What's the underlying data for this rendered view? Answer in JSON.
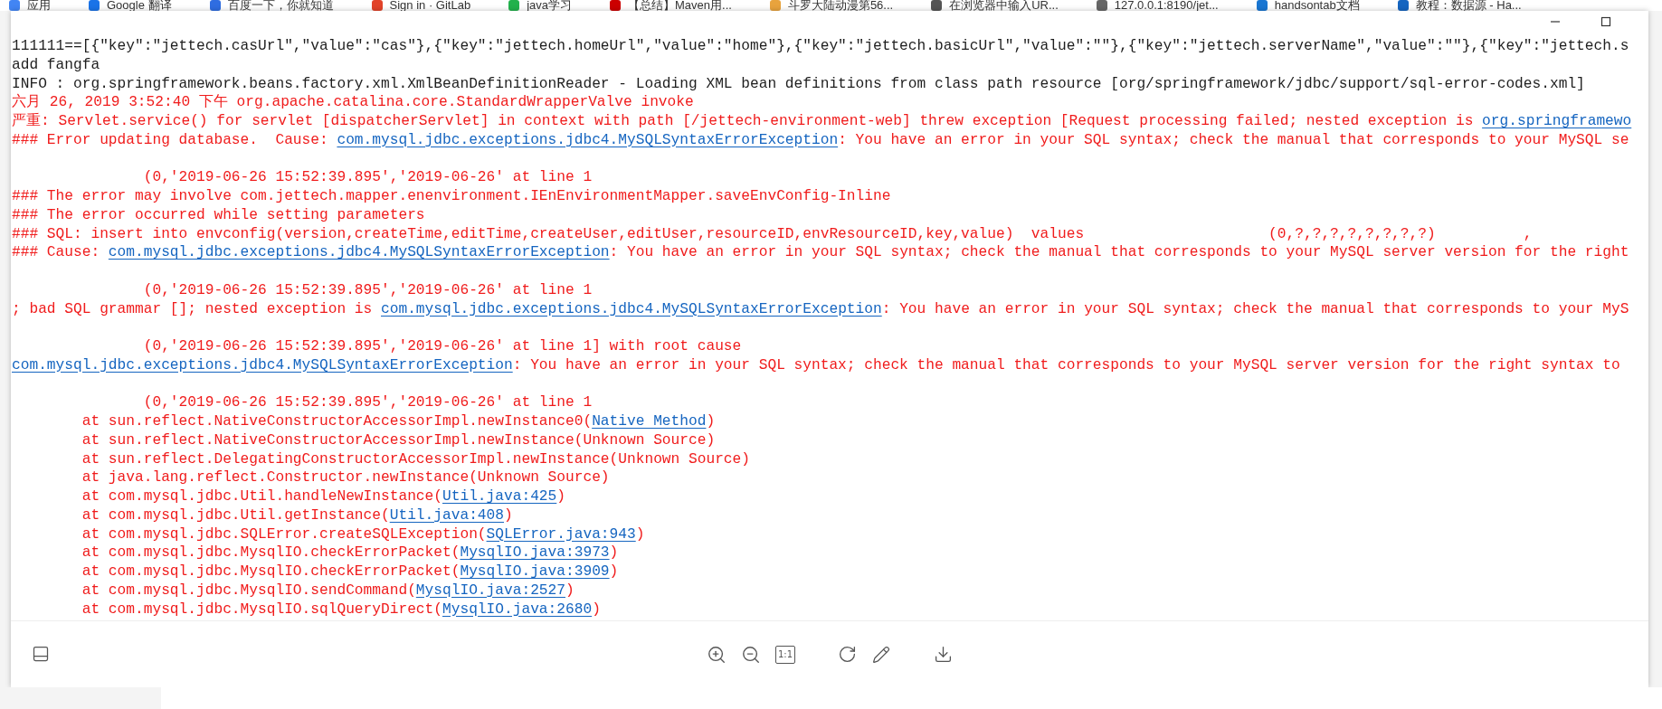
{
  "bookmarks": [
    {
      "label": "应用"
    },
    {
      "label": "Google 翻译"
    },
    {
      "label": "百度一下，你就知道"
    },
    {
      "label": "Sign in · GitLab"
    },
    {
      "label": "java学习"
    },
    {
      "label": "【总结】Maven用..."
    },
    {
      "label": "斗罗大陆动漫第56..."
    },
    {
      "label": "在浏览器中输入UR..."
    },
    {
      "label": "127.0.0.1:8190/jet..."
    },
    {
      "label": "handsontab文档"
    },
    {
      "label": "教程：数据源 - Ha..."
    }
  ],
  "log_lines": [
    {
      "kind": "text",
      "error": false,
      "segments": [
        {
          "text": "111111==[{\"key\":\"jettech.casUrl\",\"value\":\"cas\"},{\"key\":\"jettech.homeUrl\",\"value\":\"home\"},{\"key\":\"jettech.basicUrl\",\"value\":\"\"},{\"key\":\"jettech.serverName\",\"value\":\"\"},{\"key\":\"jettech.s",
          "link": false
        }
      ]
    },
    {
      "kind": "text",
      "error": false,
      "segments": [
        {
          "text": "add fangfa",
          "link": false
        }
      ]
    },
    {
      "kind": "text",
      "error": false,
      "segments": [
        {
          "text": "INFO : org.springframework.beans.factory.xml.XmlBeanDefinitionReader - Loading XML bean definitions from class path resource [org/springframework/jdbc/support/sql-error-codes.xml]",
          "link": false
        }
      ]
    },
    {
      "kind": "text",
      "error": true,
      "segments": [
        {
          "text": "六月 26, 2019 3:52:40 下午 org.apache.catalina.core.StandardWrapperValve invoke",
          "link": false
        }
      ]
    },
    {
      "kind": "text",
      "error": true,
      "segments": [
        {
          "text": "严重: Servlet.service() for servlet [dispatcherServlet] in context with path [/jettech-environment-web] threw exception [Request processing failed; nested exception is ",
          "link": false
        },
        {
          "text": "org.springframewo",
          "link": true
        }
      ]
    },
    {
      "kind": "text",
      "error": true,
      "segments": [
        {
          "text": "### Error updating database.  Cause: ",
          "link": false
        },
        {
          "text": "com.mysql.jdbc.exceptions.jdbc4.MySQLSyntaxErrorException",
          "link": true
        },
        {
          "text": ": You have an error in your SQL syntax; check the manual that corresponds to your MySQL se",
          "link": false
        }
      ]
    },
    {
      "kind": "blank"
    },
    {
      "kind": "text",
      "error": true,
      "segments": [
        {
          "text": "               (0,'2019-06-26 15:52:39.895','2019-06-26' at line 1",
          "link": false
        }
      ]
    },
    {
      "kind": "text",
      "error": true,
      "segments": [
        {
          "text": "### The error may involve com.jettech.mapper.enenvironment.IEnEnvironmentMapper.saveEnvConfig-Inline",
          "link": false
        }
      ]
    },
    {
      "kind": "text",
      "error": true,
      "segments": [
        {
          "text": "### The error occurred while setting parameters",
          "link": false
        }
      ]
    },
    {
      "kind": "text",
      "error": true,
      "segments": [
        {
          "text": "### SQL: insert into envconfig(version,createTime,editTime,createUser,editUser,resourceID,envResourceID,key,value)  values                     (0,?,?,?,?,?,?,?,?)          ,",
          "link": false
        }
      ]
    },
    {
      "kind": "text",
      "error": true,
      "segments": [
        {
          "text": "### Cause: ",
          "link": false
        },
        {
          "text": "com.mysql.jdbc.exceptions.jdbc4.MySQLSyntaxErrorException",
          "link": true
        },
        {
          "text": ": You have an error in your SQL syntax; check the manual that corresponds to your MySQL server version for the right",
          "link": false
        }
      ]
    },
    {
      "kind": "blank"
    },
    {
      "kind": "text",
      "error": true,
      "segments": [
        {
          "text": "               (0,'2019-06-26 15:52:39.895','2019-06-26' at line 1",
          "link": false
        }
      ]
    },
    {
      "kind": "text",
      "error": true,
      "segments": [
        {
          "text": "; bad SQL grammar []; nested exception is ",
          "link": false
        },
        {
          "text": "com.mysql.jdbc.exceptions.jdbc4.MySQLSyntaxErrorException",
          "link": true
        },
        {
          "text": ": You have an error in your SQL syntax; check the manual that corresponds to your MyS",
          "link": false
        }
      ]
    },
    {
      "kind": "blank"
    },
    {
      "kind": "text",
      "error": true,
      "segments": [
        {
          "text": "               (0,'2019-06-26 15:52:39.895','2019-06-26' at line 1] with root cause",
          "link": false
        }
      ]
    },
    {
      "kind": "text",
      "error": true,
      "segments": [
        {
          "text": "com.mysql.jdbc.exceptions.jdbc4.MySQLSyntaxErrorException",
          "link": true
        },
        {
          "text": ": You have an error in your SQL syntax; check the manual that corresponds to your MySQL server version for the right syntax to",
          "link": false
        }
      ]
    },
    {
      "kind": "blank"
    },
    {
      "kind": "text",
      "error": true,
      "segments": [
        {
          "text": "               (0,'2019-06-26 15:52:39.895','2019-06-26' at line 1",
          "link": false
        }
      ]
    },
    {
      "kind": "text",
      "error": true,
      "segments": [
        {
          "text": "        at sun.reflect.NativeConstructorAccessorImpl.newInstance0(",
          "link": false
        },
        {
          "text": "Native Method",
          "link": true
        },
        {
          "text": ")",
          "link": false
        }
      ]
    },
    {
      "kind": "text",
      "error": true,
      "segments": [
        {
          "text": "        at sun.reflect.NativeConstructorAccessorImpl.newInstance(Unknown Source)",
          "link": false
        }
      ]
    },
    {
      "kind": "text",
      "error": true,
      "segments": [
        {
          "text": "        at sun.reflect.DelegatingConstructorAccessorImpl.newInstance(Unknown Source)",
          "link": false
        }
      ]
    },
    {
      "kind": "text",
      "error": true,
      "segments": [
        {
          "text": "        at java.lang.reflect.Constructor.newInstance(Unknown Source)",
          "link": false
        }
      ]
    },
    {
      "kind": "text",
      "error": true,
      "segments": [
        {
          "text": "        at com.mysql.jdbc.Util.handleNewInstance(",
          "link": false
        },
        {
          "text": "Util.java:425",
          "link": true
        },
        {
          "text": ")",
          "link": false
        }
      ]
    },
    {
      "kind": "text",
      "error": true,
      "segments": [
        {
          "text": "        at com.mysql.jdbc.Util.getInstance(",
          "link": false
        },
        {
          "text": "Util.java:408",
          "link": true
        },
        {
          "text": ")",
          "link": false
        }
      ]
    },
    {
      "kind": "text",
      "error": true,
      "segments": [
        {
          "text": "        at com.mysql.jdbc.SQLError.createSQLException(",
          "link": false
        },
        {
          "text": "SQLError.java:943",
          "link": true
        },
        {
          "text": ")",
          "link": false
        }
      ]
    },
    {
      "kind": "text",
      "error": true,
      "segments": [
        {
          "text": "        at com.mysql.jdbc.MysqlIO.checkErrorPacket(",
          "link": false
        },
        {
          "text": "MysqlIO.java:3973",
          "link": true
        },
        {
          "text": ")",
          "link": false
        }
      ]
    },
    {
      "kind": "text",
      "error": true,
      "segments": [
        {
          "text": "        at com.mysql.jdbc.MysqlIO.checkErrorPacket(",
          "link": false
        },
        {
          "text": "MysqlIO.java:3909",
          "link": true
        },
        {
          "text": ")",
          "link": false
        }
      ]
    },
    {
      "kind": "text",
      "error": true,
      "segments": [
        {
          "text": "        at com.mysql.jdbc.MysqlIO.sendCommand(",
          "link": false
        },
        {
          "text": "MysqlIO.java:2527",
          "link": true
        },
        {
          "text": ")",
          "link": false
        }
      ]
    },
    {
      "kind": "text",
      "error": true,
      "segments": [
        {
          "text": "        at com.mysql.jdbc.MysqlIO.sqlQueryDirect(",
          "link": false
        },
        {
          "text": "MysqlIO.java:2680",
          "link": true
        },
        {
          "text": ")",
          "link": false
        }
      ]
    }
  ],
  "toolbar": {
    "actual_size": "1:1"
  }
}
